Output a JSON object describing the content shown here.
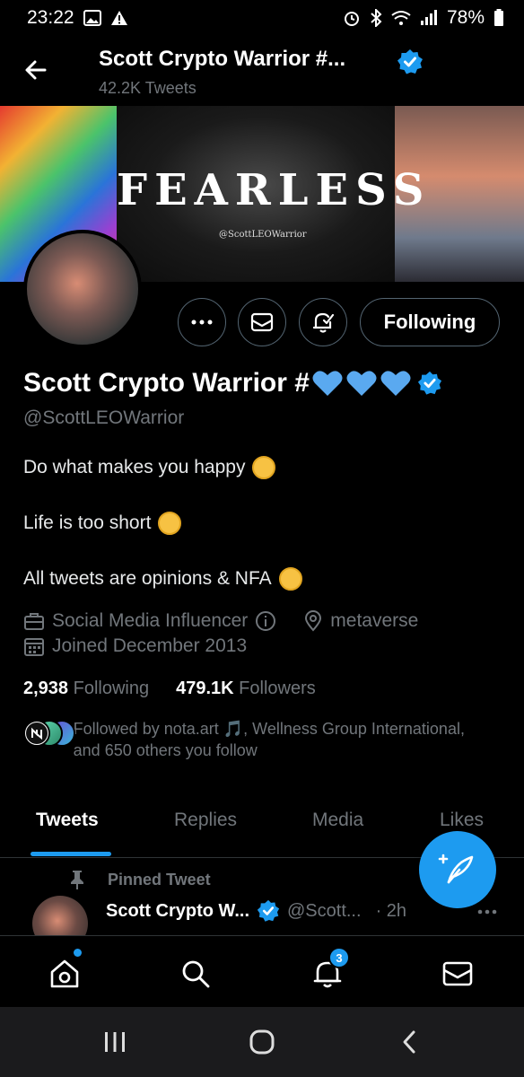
{
  "status_bar": {
    "time": "23:22",
    "battery": "78%",
    "icons": [
      "image-icon",
      "warning-icon",
      "alarm-icon",
      "bluetooth-icon",
      "wifi-icon",
      "signal-icon",
      "battery-icon"
    ]
  },
  "header": {
    "name": "Scott Crypto Warrior #...",
    "tweet_count": "42.2K Tweets",
    "verified": true
  },
  "banner": {
    "title": "FEARLESS",
    "handle": "@ScottLEOWarrior"
  },
  "actions": {
    "following_label": "Following"
  },
  "profile": {
    "display_name": "Scott Crypto Warrior #",
    "handle": "@ScottLEOWarrior",
    "bio": [
      "Do what makes you happy",
      "Life is too short",
      "All tweets are opinions & NFA"
    ],
    "category": "Social Media Influencer",
    "location": "metaverse",
    "joined": "Joined December 2013",
    "following_count": "2,938",
    "following_label": "Following",
    "followers_count": "479.1K",
    "followers_label": "Followers",
    "followed_by": "Followed by nota.art 🎵, Wellness Group International, and 650 others you follow"
  },
  "tabs": [
    {
      "label": "Tweets",
      "active": true
    },
    {
      "label": "Replies",
      "active": false
    },
    {
      "label": "Media",
      "active": false
    },
    {
      "label": "Likes",
      "active": false
    }
  ],
  "pinned_tweet": {
    "label": "Pinned Tweet",
    "author": "Scott Crypto W...",
    "handle": "@Scott...",
    "time": "· 2h"
  },
  "bottom_nav": {
    "notification_count": "3"
  },
  "colors": {
    "accent": "#1d9bf0",
    "heart": "#5aa9f0",
    "muted": "#71767b",
    "background": "#000000"
  }
}
